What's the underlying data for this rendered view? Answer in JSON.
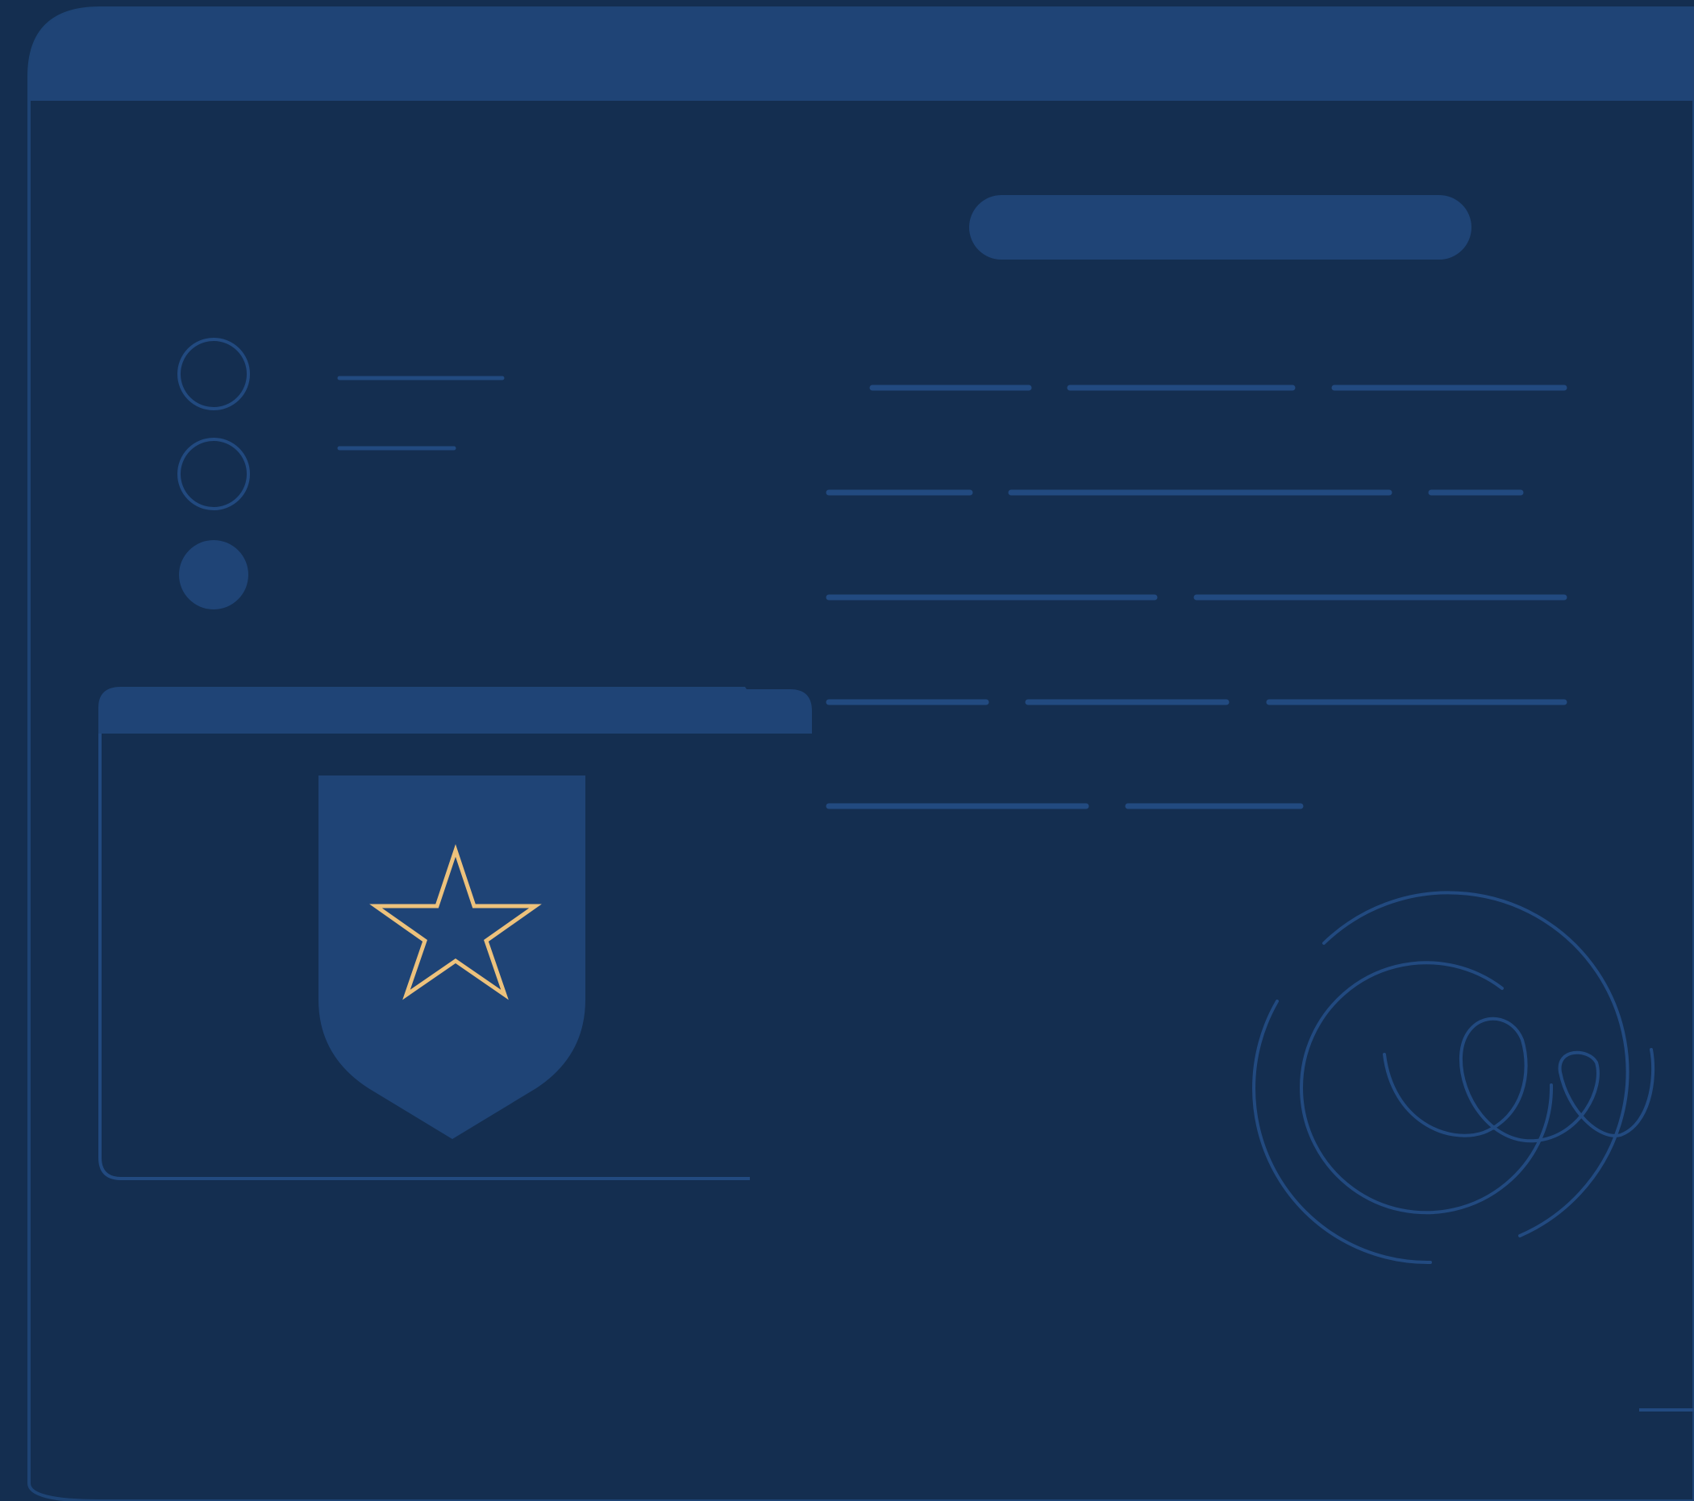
{
  "theme": {
    "background": "#142e50",
    "panel": "#142e50",
    "panel_dark": "#112743",
    "accent_fill": "#1f4476",
    "line": "#224a80",
    "star": "#edc27c"
  },
  "browser_window": {
    "title_bar": "",
    "heading_placeholder": "",
    "text_lines": 14
  },
  "sidebar": {
    "options": [
      {
        "state": "unselected"
      },
      {
        "state": "unselected"
      },
      {
        "state": "selected"
      }
    ]
  },
  "badge_card": {
    "icon": "star-icon",
    "emblem": "shield-icon"
  },
  "signature": {
    "icon": "signature-scribble-icon"
  }
}
